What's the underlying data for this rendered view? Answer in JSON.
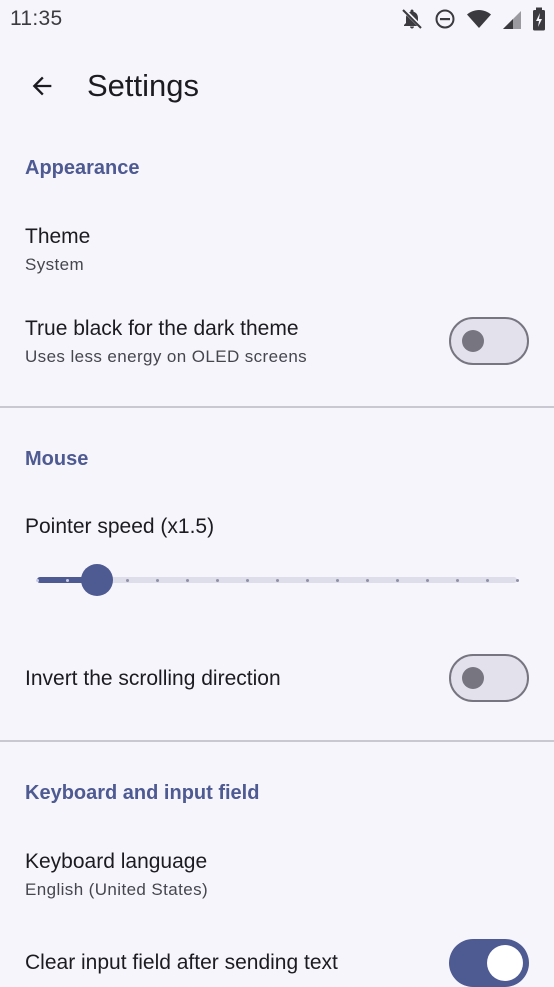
{
  "status_bar": {
    "time": "11:35",
    "icons": [
      "notifications-off-icon",
      "do-not-disturb-icon",
      "wifi-icon",
      "cell-signal-icon",
      "battery-charging-icon"
    ]
  },
  "top_bar": {
    "title": "Settings",
    "back_icon": "arrow-back-icon"
  },
  "sections": {
    "appearance": {
      "header": "Appearance",
      "theme": {
        "title": "Theme",
        "summary": "System"
      },
      "true_black": {
        "title": "True black for the dark theme",
        "summary": "Uses less energy on OLED screens",
        "checked": false
      }
    },
    "mouse": {
      "header": "Mouse",
      "pointer_speed": {
        "title": "Pointer speed (x1.5)",
        "min": 1,
        "max": 17,
        "value": 3,
        "steps": 17
      },
      "invert_scroll": {
        "title": "Invert the scrolling direction",
        "checked": false
      }
    },
    "keyboard": {
      "header": "Keyboard and input field",
      "language": {
        "title": "Keyboard language",
        "summary": "English (United States)"
      },
      "clear_input": {
        "title": "Clear input field after sending text",
        "checked": true
      }
    }
  },
  "colors": {
    "accent": "#4E5A92",
    "background": "#F6F5FB",
    "divider": "#C9C8D1",
    "switch_off_outline": "#777680"
  }
}
